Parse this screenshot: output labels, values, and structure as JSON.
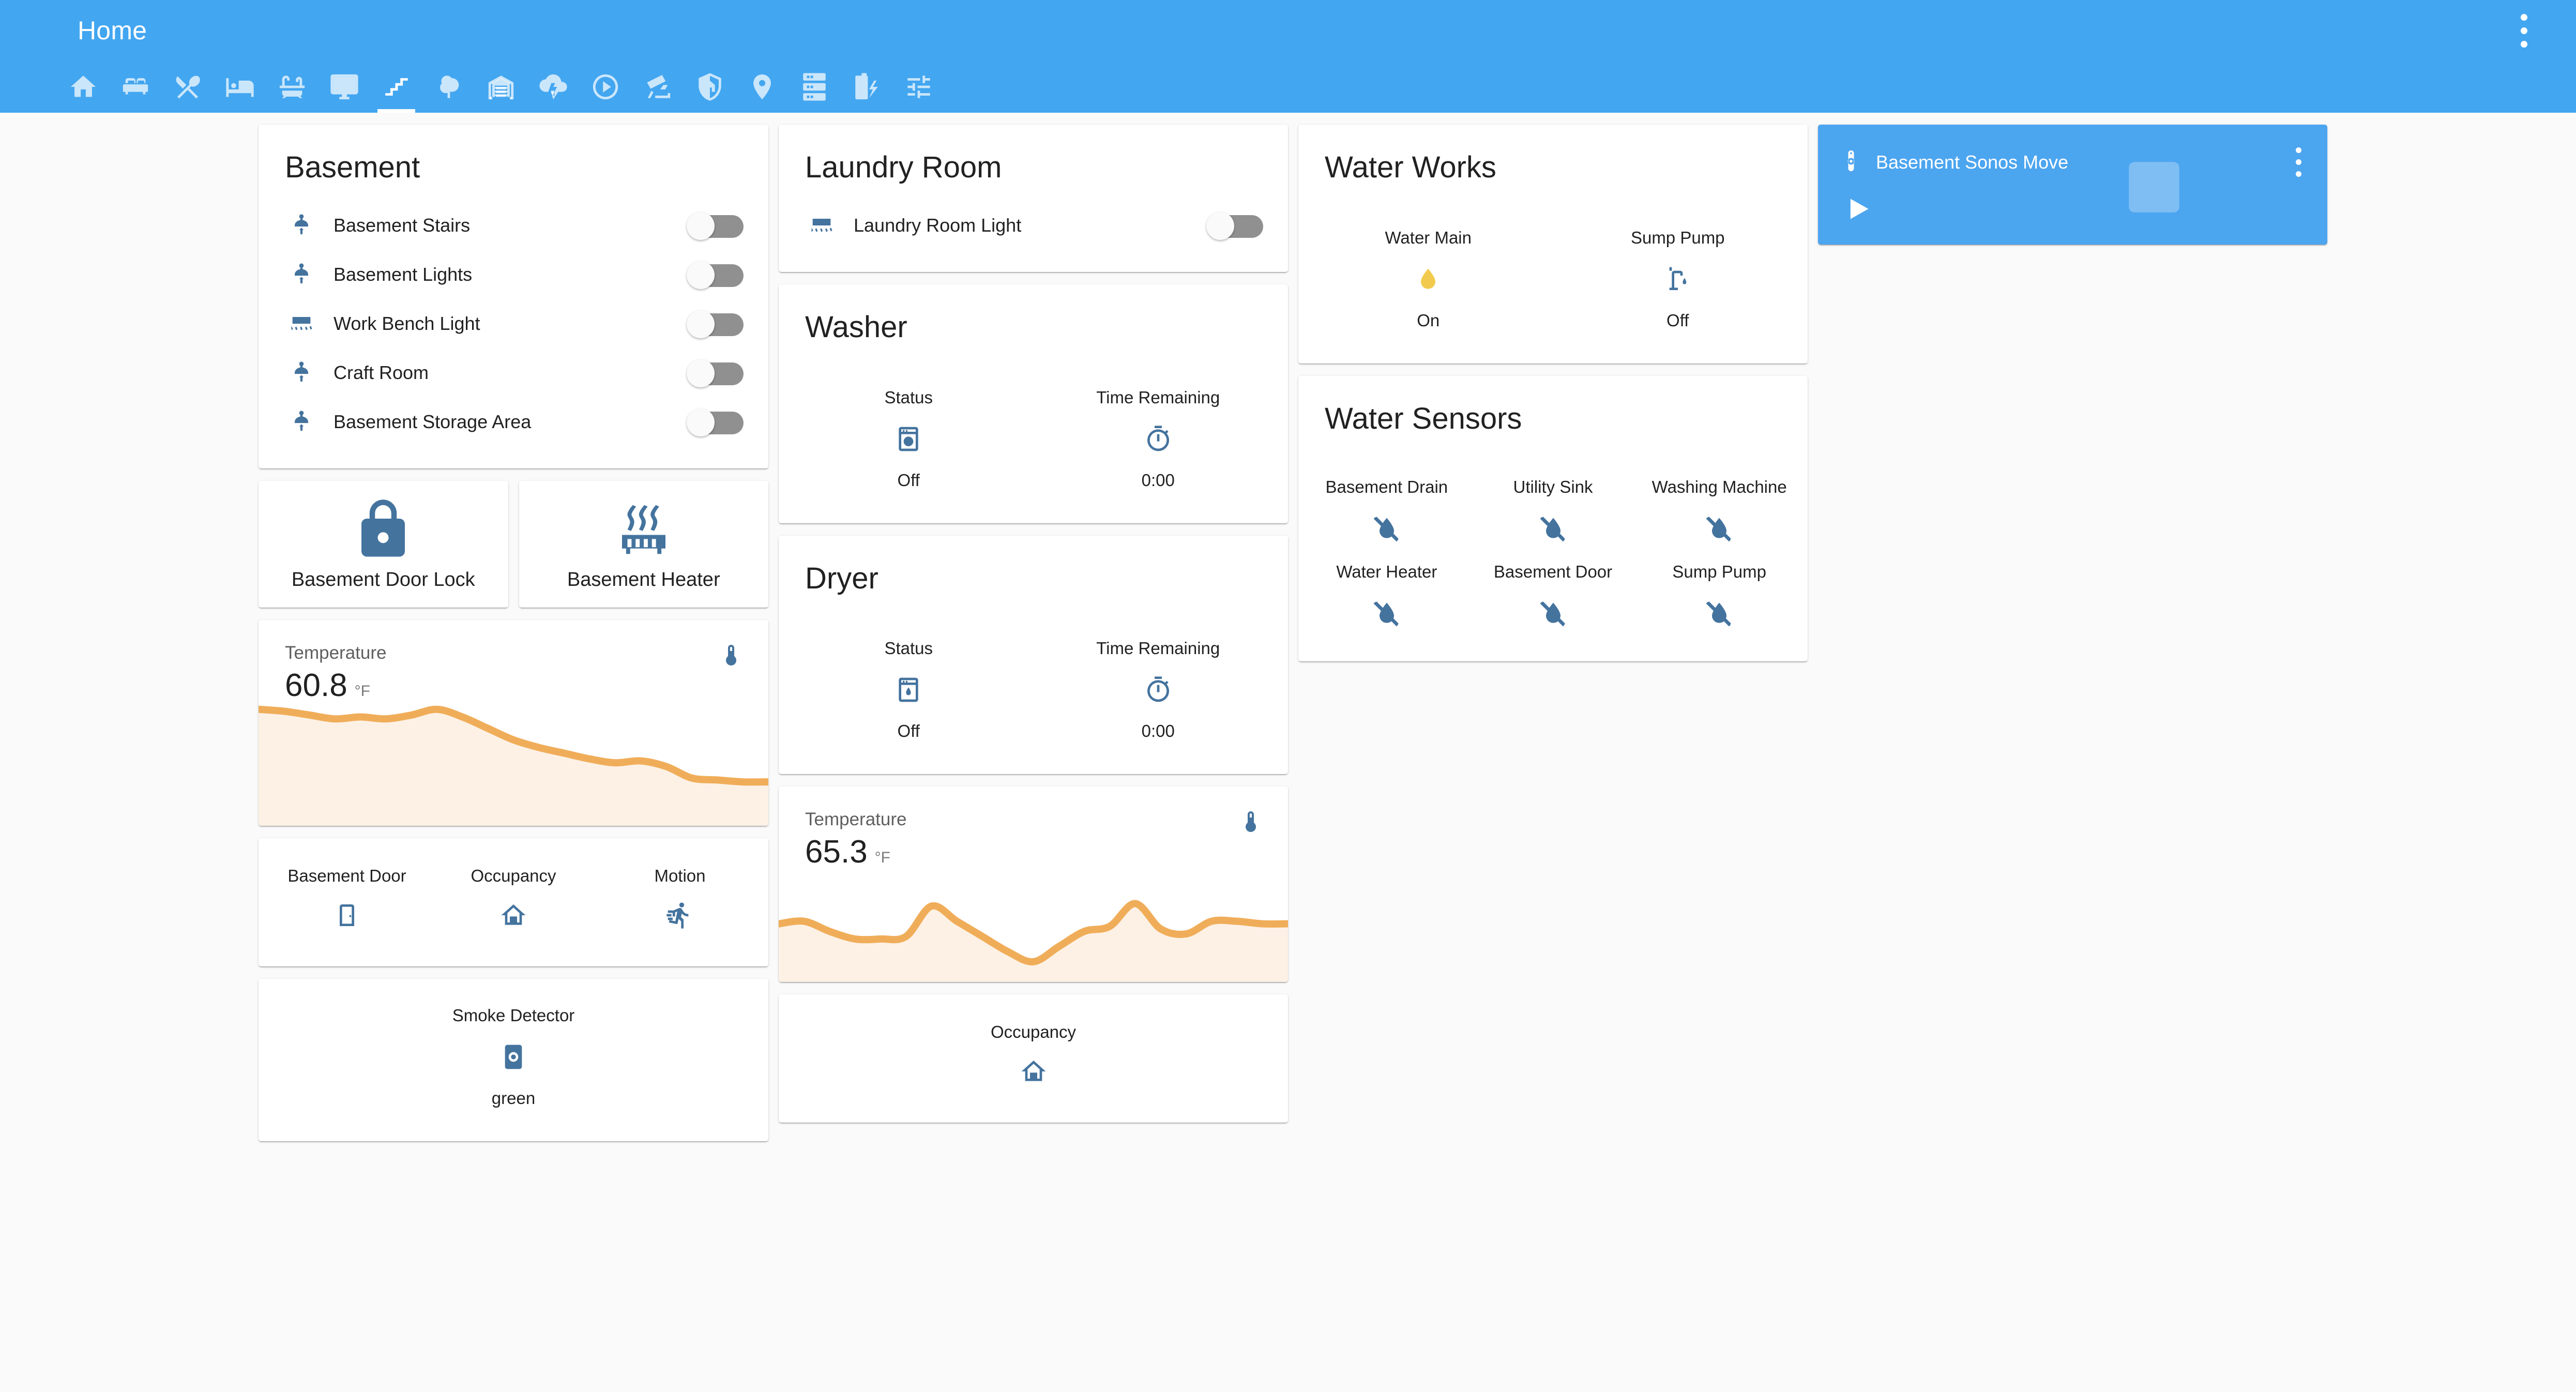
{
  "header": {
    "title": "Home",
    "overflow_menu": "more-options",
    "accent_color": "#43a6f0",
    "tabs": [
      {
        "name": "home",
        "icon": "home-icon",
        "active": false
      },
      {
        "name": "living-room",
        "icon": "sofa-icon",
        "active": false
      },
      {
        "name": "kitchen",
        "icon": "silverware-icon",
        "active": false
      },
      {
        "name": "bedroom",
        "icon": "bed-icon",
        "active": false
      },
      {
        "name": "bathroom",
        "icon": "bathtub-icon",
        "active": false
      },
      {
        "name": "office",
        "icon": "monitor-icon",
        "active": false
      },
      {
        "name": "basement",
        "icon": "stairs-icon",
        "active": true
      },
      {
        "name": "outside",
        "icon": "tree-icon",
        "active": false
      },
      {
        "name": "garage",
        "icon": "garage-icon",
        "active": false
      },
      {
        "name": "weather",
        "icon": "weather-lightning-icon",
        "active": false
      },
      {
        "name": "media",
        "icon": "play-circle-icon",
        "active": false
      },
      {
        "name": "cameras",
        "icon": "cctv-icon",
        "active": false
      },
      {
        "name": "security",
        "icon": "shield-home-icon",
        "active": false
      },
      {
        "name": "presence",
        "icon": "map-marker-icon",
        "active": false
      },
      {
        "name": "system",
        "icon": "server-icon",
        "active": false
      },
      {
        "name": "batteries",
        "icon": "battery-charging-icon",
        "active": false
      },
      {
        "name": "settings",
        "icon": "tune-icon",
        "active": false
      }
    ]
  },
  "basement_card": {
    "title": "Basement",
    "lights": [
      {
        "name": "Basement Stairs",
        "icon": "ceiling-light-icon",
        "state": "off"
      },
      {
        "name": "Basement Lights",
        "icon": "ceiling-light-icon",
        "state": "off"
      },
      {
        "name": "Work Bench Light",
        "icon": "desk-lamp-icon",
        "state": "off"
      },
      {
        "name": "Craft Room",
        "icon": "ceiling-light-icon",
        "state": "off"
      },
      {
        "name": "Basement Storage Area",
        "icon": "ceiling-light-icon",
        "state": "off"
      }
    ]
  },
  "buttons": {
    "door_lock": {
      "label": "Basement Door Lock",
      "icon": "lock-icon"
    },
    "heater": {
      "label": "Basement Heater",
      "icon": "radiator-icon"
    }
  },
  "basement_temperature": {
    "label": "Temperature",
    "value": "60.8",
    "unit": "°F",
    "icon": "thermometer-icon"
  },
  "basement_sensors": [
    {
      "label": "Basement Door",
      "icon": "door-closed-icon"
    },
    {
      "label": "Occupancy",
      "icon": "home-outline-icon"
    },
    {
      "label": "Motion",
      "icon": "run-icon"
    }
  ],
  "smoke_detector": {
    "label": "Smoke Detector",
    "icon": "smoke-detector-icon",
    "state": "green"
  },
  "laundry_card": {
    "title": "Laundry Room",
    "lights": [
      {
        "name": "Laundry Room Light",
        "icon": "desk-lamp-icon",
        "state": "off"
      }
    ]
  },
  "washer_card": {
    "title": "Washer",
    "items": [
      {
        "label": "Status",
        "icon": "washing-machine-icon",
        "state": "Off"
      },
      {
        "label": "Time Remaining",
        "icon": "timer-icon",
        "state": "0:00"
      }
    ]
  },
  "dryer_card": {
    "title": "Dryer",
    "items": [
      {
        "label": "Status",
        "icon": "tumble-dryer-icon",
        "state": "Off"
      },
      {
        "label": "Time Remaining",
        "icon": "timer-icon",
        "state": "0:00"
      }
    ]
  },
  "laundry_temperature": {
    "label": "Temperature",
    "value": "65.3",
    "unit": "°F",
    "icon": "thermometer-icon"
  },
  "laundry_occupancy": {
    "label": "Occupancy",
    "icon": "home-outline-icon"
  },
  "water_works_card": {
    "title": "Water Works",
    "items": [
      {
        "label": "Water Main",
        "icon": "water-drop-icon",
        "state": "On",
        "color": "#f2cb4e"
      },
      {
        "label": "Sump Pump",
        "icon": "water-pump-icon",
        "state": "Off",
        "color": "#44739e"
      }
    ]
  },
  "water_sensors_card": {
    "title": "Water Sensors",
    "rows": [
      [
        {
          "label": "Basement Drain",
          "icon": "water-off-icon"
        },
        {
          "label": "Utility Sink",
          "icon": "water-off-icon"
        },
        {
          "label": "Washing Machine",
          "icon": "water-off-icon"
        }
      ],
      [
        {
          "label": "Water Heater",
          "icon": "water-off-icon"
        },
        {
          "label": "Basement Door",
          "icon": "water-off-icon"
        },
        {
          "label": "Sump Pump",
          "icon": "water-off-icon"
        }
      ]
    ]
  },
  "media_player": {
    "name": "Basement Sonos Move",
    "speaker_icon": "speaker-icon",
    "play_icon": "play-icon",
    "art_icon": "music-box-icon",
    "menu_icon": "more-options-icon",
    "background_color": "#4ca5ef"
  },
  "chart_data": [
    {
      "type": "area",
      "title": "Temperature",
      "name": "basement-temperature-history",
      "ylabel": "°F",
      "current_value": 60.8,
      "unit": "°F",
      "line_color": "#f0ad59",
      "fill_color": "#fdf1e5",
      "ylim": [
        58.5,
        65.0
      ],
      "x": [
        0,
        1,
        2,
        3,
        4,
        5,
        6,
        7,
        8,
        9,
        10,
        11,
        12,
        13,
        14,
        15,
        16,
        17,
        18,
        19,
        20
      ],
      "values": [
        64.6,
        64.5,
        64.3,
        64.1,
        64.2,
        64.1,
        64.3,
        64.6,
        64.2,
        63.6,
        63.0,
        62.6,
        62.3,
        62.0,
        61.8,
        61.9,
        61.6,
        61.0,
        60.9,
        60.8,
        60.8
      ]
    },
    {
      "type": "area",
      "title": "Temperature",
      "name": "laundry-temperature-history",
      "ylabel": "°F",
      "current_value": 65.3,
      "unit": "°F",
      "line_color": "#f0ad59",
      "fill_color": "#fdf1e5",
      "ylim": [
        63.0,
        67.5
      ],
      "x": [
        0,
        1,
        2,
        3,
        4,
        5,
        6,
        7,
        8,
        9,
        10,
        11,
        12,
        13,
        14,
        15,
        16,
        17,
        18,
        19,
        20
      ],
      "values": [
        65.3,
        65.4,
        65.0,
        64.7,
        64.7,
        64.8,
        66.0,
        65.4,
        64.8,
        64.2,
        63.8,
        64.4,
        65.0,
        65.2,
        66.1,
        65.1,
        64.9,
        65.4,
        65.4,
        65.3,
        65.3
      ]
    }
  ]
}
